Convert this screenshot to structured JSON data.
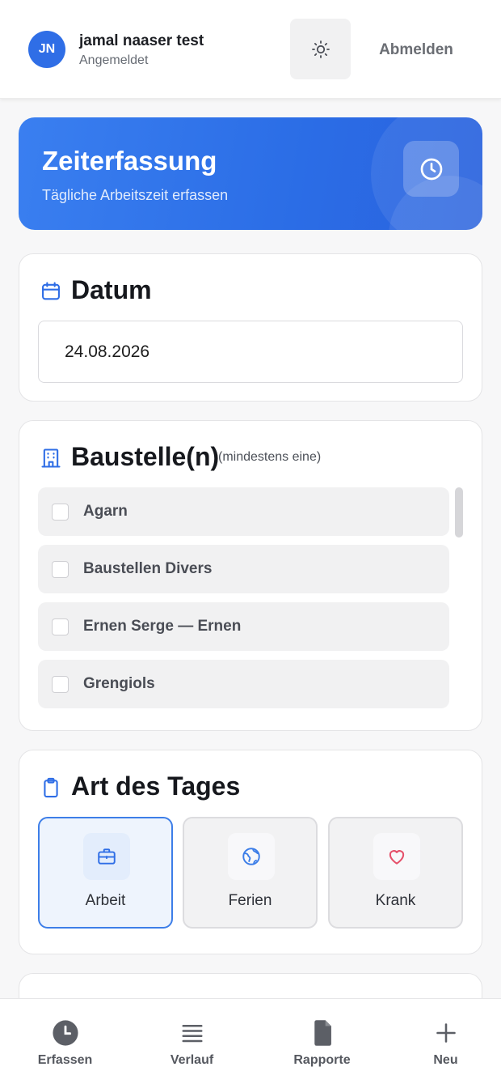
{
  "user": {
    "initials": "JN",
    "name": "jamal naaser test",
    "status": "Angemeldet"
  },
  "header": {
    "theme_icon": "sun-icon",
    "logout_label": "Abmelden"
  },
  "hero": {
    "title": "Zeiterfassung",
    "subtitle": "Tägliche Arbeitszeit erfassen",
    "icon": "clock-icon"
  },
  "date_section": {
    "title": "Datum",
    "icon": "calendar-icon",
    "value": "24.08.2026"
  },
  "site_section": {
    "title": "Baustelle(n)",
    "hint": "(mindestens eine)",
    "icon": "building-icon",
    "items": [
      {
        "label": "Agarn",
        "checked": false
      },
      {
        "label": "Baustellen Divers",
        "checked": false
      },
      {
        "label": "Ernen Serge — Ernen",
        "checked": false
      },
      {
        "label": "Grengiols",
        "checked": false
      }
    ]
  },
  "day_type_section": {
    "title": "Art des Tages",
    "icon": "clipboard-icon",
    "options": [
      {
        "label": "Arbeit",
        "icon": "briefcase-icon",
        "selected": true
      },
      {
        "label": "Ferien",
        "icon": "globe-icon",
        "selected": false
      },
      {
        "label": "Krank",
        "icon": "heart-icon",
        "selected": false
      }
    ]
  },
  "bottom_nav": {
    "items": [
      {
        "label": "Erfassen",
        "icon": "clock-icon"
      },
      {
        "label": "Verlauf",
        "icon": "list-icon"
      },
      {
        "label": "Rapporte",
        "icon": "document-icon"
      },
      {
        "label": "Neu",
        "icon": "plus-icon"
      }
    ]
  },
  "colors": {
    "accent": "#2f6ee6",
    "heart": "#e5506a",
    "globe": "#3d7ee8"
  }
}
